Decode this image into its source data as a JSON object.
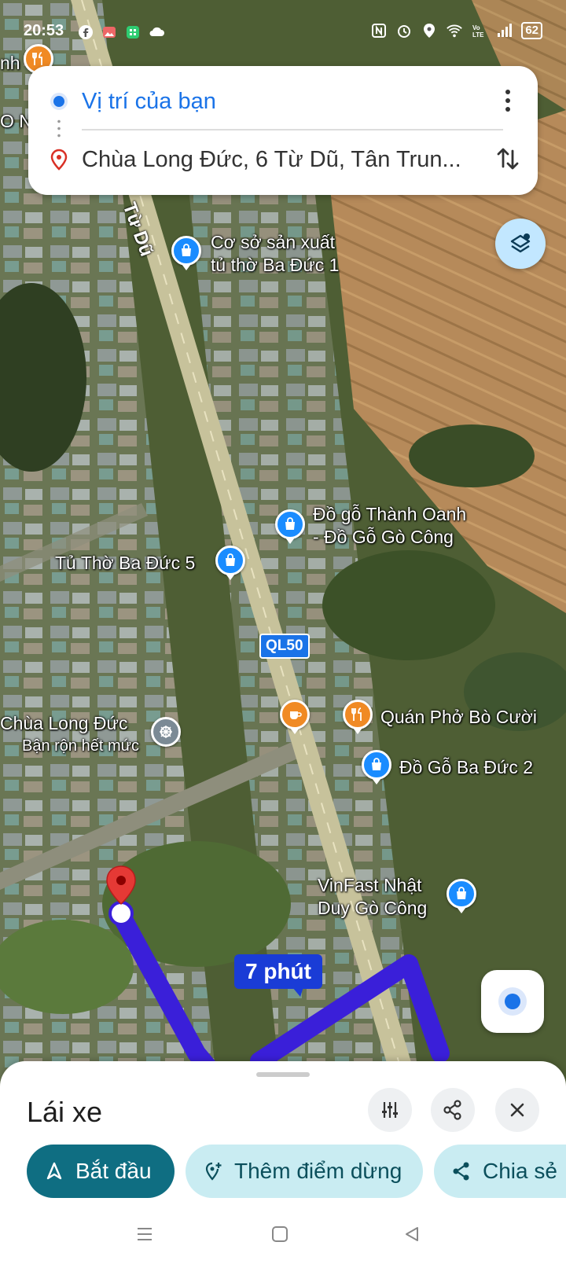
{
  "status_bar": {
    "time": "20:53",
    "battery": "62",
    "left_icons": [
      "facebook-icon",
      "photos-icon",
      "app-icon",
      "cloud-icon"
    ],
    "right_icons": [
      "nfc-icon",
      "alarm-icon",
      "location-icon",
      "wifi-icon",
      "volte-icon",
      "signal-icon",
      "battery-icon"
    ]
  },
  "directions": {
    "origin": "Vị trí của bạn",
    "destination": "Chùa Long Đức, 6 Từ Dũ, Tân Trun..."
  },
  "map": {
    "street_name": "Từ Dũ",
    "road_shield": "QL50",
    "eta": "7 phút",
    "edge_labels": {
      "top_left_1": "nh",
      "top_left_2": "O Nh"
    },
    "places": [
      {
        "name_line1": "Cơ sở sản xuất",
        "name_line2": "tủ thờ Ba Đức 1",
        "icon": "shopping-bag-icon"
      },
      {
        "name_line1": "Đồ gỗ Thành Oanh",
        "name_line2": "- Đồ Gỗ Gò Công",
        "icon": "shopping-bag-icon"
      },
      {
        "name_line1": "Tủ Thờ Ba Đức 5",
        "icon": "shopping-bag-icon"
      },
      {
        "name_line1": "Chùa Long Đức",
        "name_line2": "Bận rộn hết mức",
        "icon": "temple-icon"
      },
      {
        "name_line1": "Quán Phở Bò Cười",
        "icon": "restaurant-icon"
      },
      {
        "name_line1": "Đồ Gỗ Ba Đức 2",
        "icon": "shopping-bag-icon"
      },
      {
        "name_line1": "VinFast Nhật",
        "name_line2": "Duy Gò Công",
        "icon": "shopping-bag-icon"
      }
    ],
    "colors": {
      "route": "#3a1fd9",
      "pin_blue": "#1a8cff",
      "pin_orange": "#f08a24"
    }
  },
  "sheet": {
    "mode_title": "Lái xe",
    "start_label": "Bắt đầu",
    "add_stop_label": "Thêm điểm dừng",
    "share_label": "Chia sẻ"
  }
}
